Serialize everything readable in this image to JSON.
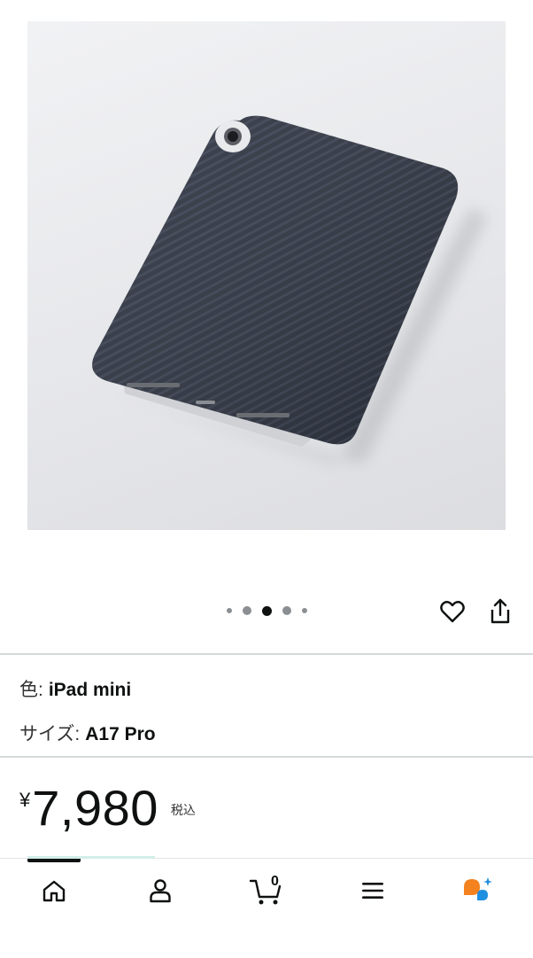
{
  "product": {
    "image_alt": "Aramid fiber case for iPad mini",
    "carousel": {
      "count": 5,
      "active_index": 2
    }
  },
  "actions": {
    "wishlist_icon": "heart-icon",
    "share_icon": "share-icon"
  },
  "variations": {
    "color_label": "色:",
    "color_value": "iPad mini",
    "size_label": "サイズ:",
    "size_value": "A17 Pro"
  },
  "price": {
    "symbol": "¥",
    "whole": "7,980",
    "tax_note": "税込"
  },
  "bottom_nav": {
    "items": [
      {
        "name": "home",
        "icon": "home-icon"
      },
      {
        "name": "account",
        "icon": "person-icon"
      },
      {
        "name": "cart",
        "icon": "cart-icon",
        "count": "0"
      },
      {
        "name": "menu",
        "icon": "menu-icon"
      },
      {
        "name": "rufus",
        "icon": "assistant-icon"
      }
    ]
  },
  "colors": {
    "text": "#0f1111",
    "divider": "#d5d9d9",
    "assistant_orange": "#f3821f",
    "assistant_blue": "#1f8fe0"
  }
}
